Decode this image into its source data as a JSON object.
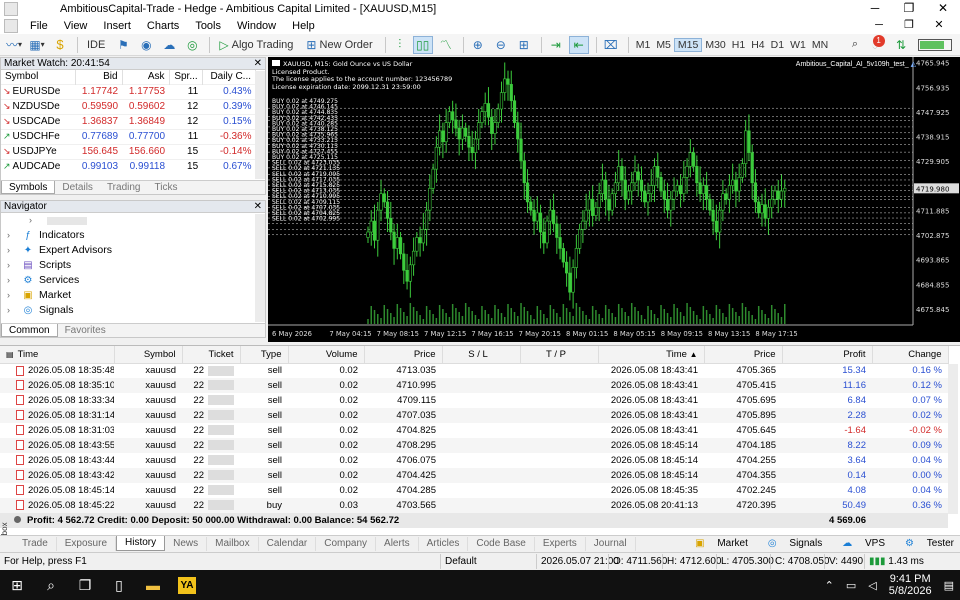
{
  "window": {
    "title": "AmbitiousCapital-Trade - Hedge - Ambitious Capital Limited - [XAUUSD,M15]"
  },
  "menu": [
    "File",
    "View",
    "Insert",
    "Charts",
    "Tools",
    "Window",
    "Help"
  ],
  "toolbar": {
    "ide": "IDE",
    "algo_trading": "Algo Trading",
    "new_order": "New Order",
    "timeframes": [
      "M1",
      "M5",
      "M15",
      "M30",
      "H1",
      "H4",
      "D1",
      "W1",
      "MN"
    ],
    "active_tf": "M15",
    "notifications": "1"
  },
  "market_watch": {
    "title": "Market Watch: 20:41:54",
    "columns": [
      "Symbol",
      "Bid",
      "Ask",
      "Spr...",
      "Daily C..."
    ],
    "rows": [
      {
        "symbol": "EURUSDe",
        "dir": "down",
        "bid": "1.17742",
        "ask": "1.17753",
        "spread": "11",
        "change": "0.43%"
      },
      {
        "symbol": "NZDUSDe",
        "dir": "down",
        "bid": "0.59590",
        "ask": "0.59602",
        "spread": "12",
        "change": "0.39%"
      },
      {
        "symbol": "USDCADe",
        "dir": "down",
        "bid": "1.36837",
        "ask": "1.36849",
        "spread": "12",
        "change": "0.15%"
      },
      {
        "symbol": "USDCHFe",
        "dir": "up",
        "bid": "0.77689",
        "ask": "0.77700",
        "spread": "11",
        "change": "-0.36%"
      },
      {
        "symbol": "USDJPYe",
        "dir": "down",
        "bid": "156.645",
        "ask": "156.660",
        "spread": "15",
        "change": "-0.14%"
      },
      {
        "symbol": "AUDCADe",
        "dir": "up",
        "bid": "0.99103",
        "ask": "0.99118",
        "spread": "15",
        "change": "0.67%"
      }
    ],
    "tabs": [
      "Symbols",
      "Details",
      "Trading",
      "Ticks"
    ]
  },
  "navigator": {
    "title": "Navigator",
    "items": [
      "Indicators",
      "Expert Advisors",
      "Scripts",
      "Services",
      "Market",
      "Signals"
    ],
    "tabs": [
      "Common",
      "Favorites"
    ]
  },
  "chart": {
    "header": "XAUUSD, M15:  Gold Ounce vs US Dollar",
    "info_lines": [
      "Licensed Product.",
      "The license applies to the account number: 123456789",
      "License expiration date: 2099.12.31 23:59:00"
    ],
    "ea_name": "Ambitious_Capital_AI_5v109h_test_",
    "current_price": "4719.980",
    "buy_labels": [
      "BUY 0.02 at 4749.275",
      "BUY 0.02 at 4746.145",
      "BUY 0.02 at 4744.835",
      "BUY 0.02 at 4742.435",
      "BUY 0.02 at 4740.285",
      "BUY 0.02 at 4738.125",
      "BUY 0.02 at 4735.965",
      "BUY 0.02 at 4733.215",
      "BUY 0.02 at 4730.115",
      "BUY 0.02 at 4727.455",
      "BUY 0.02 at 4725.115"
    ],
    "sell_labels": [
      "SELL 0.02 at 4723.035",
      "SELL 0.02 at 4721.135",
      "SELL 0.02 at 4719.095",
      "SELL 0.02 at 4717.035",
      "SELL 0.02 at 4715.825",
      "SELL 0.02 at 4713.035",
      "SELL 0.02 at 4710.995",
      "SELL 0.02 at 4709.115",
      "SELL 0.02 at 4707.035",
      "SELL 0.02 at 4704.825",
      "SELL 0.02 at 4702.995"
    ],
    "y_ticks": [
      "4765.945",
      "4756.935",
      "4747.925",
      "4738.915",
      "4729.905",
      "4719.980",
      "4711.885",
      "4702.875",
      "4693.865",
      "4684.855",
      "4675.845"
    ],
    "x_ticks": [
      "6 May 2026",
      "7 May 04:15",
      "7 May 08:15",
      "7 May 12:15",
      "7 May 16:15",
      "7 May 20:15",
      "8 May 01:15",
      "8 May 05:15",
      "8 May 09:15",
      "8 May 13:15",
      "8 May 17:15"
    ],
    "closes": [
      4704,
      4708,
      4701,
      4712,
      4718,
      4715,
      4709,
      4704,
      4698,
      4702,
      4696,
      4690,
      4686,
      4692,
      4697,
      4702,
      4700,
      4705,
      4712,
      4720,
      4727,
      4735,
      4741,
      4737,
      4744,
      4748,
      4745,
      4742,
      4738,
      4742,
      4739,
      4735,
      4733,
      4738,
      4744,
      4748,
      4751,
      4746,
      4740,
      4744,
      4749,
      4755,
      4760,
      4758,
      4752,
      4744,
      4738,
      4730,
      4722,
      4715,
      4712,
      4708,
      4711,
      4704,
      4700,
      4708,
      4712,
      4707,
      4702,
      4698,
      4693,
      4689,
      4682,
      4691,
      4698,
      4705,
      4708,
      4712,
      4716,
      4710,
      4713,
      4718,
      4723,
      4716,
      4712,
      4718,
      4722,
      4728,
      4723,
      4716,
      4719,
      4722,
      4726,
      4723,
      4719,
      4715,
      4718,
      4721,
      4728,
      4724,
      4719,
      4716,
      4712,
      4716,
      4719,
      4721,
      4718,
      4724,
      4728,
      4733,
      4728,
      4722,
      4718,
      4721,
      4716,
      4712,
      4708,
      4704,
      4712,
      4718,
      4716,
      4721,
      4723,
      4719,
      4724,
      4729,
      4741,
      4733,
      4722,
      4715,
      4711,
      4714,
      4709,
      4713,
      4716,
      4719,
      4716,
      4719,
      4720
    ]
  },
  "terminal": {
    "columns": [
      "Time",
      "Symbol",
      "Ticket",
      "Type",
      "Volume",
      "Price",
      "S / L",
      "T / P",
      "Time",
      "Price",
      "Profit",
      "Change"
    ],
    "rows": [
      {
        "open": "2026.05.08 18:35:48",
        "symbol": "xauusd",
        "ticket": "22",
        "type": "sell",
        "volume": "0.02",
        "price": "4713.035",
        "sl": "",
        "tp": "",
        "close": "2026.05.08 18:43:41",
        "cprice": "4705.365",
        "profit": "15.34",
        "change": "0.16 %"
      },
      {
        "open": "2026.05.08 18:35:10",
        "symbol": "xauusd",
        "ticket": "22",
        "type": "sell",
        "volume": "0.02",
        "price": "4710.995",
        "sl": "",
        "tp": "",
        "close": "2026.05.08 18:43:41",
        "cprice": "4705.415",
        "profit": "11.16",
        "change": "0.12 %"
      },
      {
        "open": "2026.05.08 18:33:34",
        "symbol": "xauusd",
        "ticket": "22",
        "type": "sell",
        "volume": "0.02",
        "price": "4709.115",
        "sl": "",
        "tp": "",
        "close": "2026.05.08 18:43:41",
        "cprice": "4705.695",
        "profit": "6.84",
        "change": "0.07 %"
      },
      {
        "open": "2026.05.08 18:31:14",
        "symbol": "xauusd",
        "ticket": "22",
        "type": "sell",
        "volume": "0.02",
        "price": "4707.035",
        "sl": "",
        "tp": "",
        "close": "2026.05.08 18:43:41",
        "cprice": "4705.895",
        "profit": "2.28",
        "change": "0.02 %"
      },
      {
        "open": "2026.05.08 18:31:03",
        "symbol": "xauusd",
        "ticket": "22",
        "type": "sell",
        "volume": "0.02",
        "price": "4704.825",
        "sl": "",
        "tp": "",
        "close": "2026.05.08 18:43:41",
        "cprice": "4705.645",
        "profit": "-1.64",
        "change": "-0.02 %"
      },
      {
        "open": "2026.05.08 18:43:55",
        "symbol": "xauusd",
        "ticket": "22",
        "type": "sell",
        "volume": "0.02",
        "price": "4708.295",
        "sl": "",
        "tp": "",
        "close": "2026.05.08 18:45:14",
        "cprice": "4704.185",
        "profit": "8.22",
        "change": "0.09 %"
      },
      {
        "open": "2026.05.08 18:43:44",
        "symbol": "xauusd",
        "ticket": "22",
        "type": "sell",
        "volume": "0.02",
        "price": "4706.075",
        "sl": "",
        "tp": "",
        "close": "2026.05.08 18:45:14",
        "cprice": "4704.255",
        "profit": "3.64",
        "change": "0.04 %"
      },
      {
        "open": "2026.05.08 18:43:42",
        "symbol": "xauusd",
        "ticket": "22",
        "type": "sell",
        "volume": "0.02",
        "price": "4704.425",
        "sl": "",
        "tp": "",
        "close": "2026.05.08 18:45:14",
        "cprice": "4704.355",
        "profit": "0.14",
        "change": "0.00 %"
      },
      {
        "open": "2026.05.08 18:45:14",
        "symbol": "xauusd",
        "ticket": "22",
        "type": "sell",
        "volume": "0.02",
        "price": "4704.285",
        "sl": "",
        "tp": "",
        "close": "2026.05.08 18:45:35",
        "cprice": "4702.245",
        "profit": "4.08",
        "change": "0.04 %"
      },
      {
        "open": "2026.05.08 18:45:22",
        "symbol": "xauusd",
        "ticket": "22",
        "type": "buy",
        "volume": "0.03",
        "price": "4703.565",
        "sl": "",
        "tp": "",
        "close": "2026.05.08 20:41:13",
        "cprice": "4720.395",
        "profit": "50.49",
        "change": "0.36 %"
      }
    ],
    "summary": {
      "text": "Profit: 4 562.72  Credit: 0.00  Deposit: 50 000.00  Withdrawal: 0.00  Balance: 54 562.72",
      "total": "4 569.06"
    },
    "tabs": [
      "Trade",
      "Exposure",
      "History",
      "News",
      "Mailbox",
      "Calendar",
      "Company",
      "Alerts",
      "Articles",
      "Code Base",
      "Experts",
      "Journal"
    ],
    "active_tab": "History",
    "right_tabs": [
      "Market",
      "Signals",
      "VPS",
      "Tester"
    ],
    "toolbox_label": "Toolbox"
  },
  "status": {
    "help": "For Help, press F1",
    "profile": "Default",
    "bar_time": "2026.05.07 21:00",
    "open": "O: 4711.560",
    "high": "H: 4712.600",
    "low": "L: 4705.300",
    "close": "C: 4708.050",
    "volume": "V: 4490",
    "ping": "1.43 ms"
  },
  "taskbar": {
    "time": "9:41 PM",
    "date": "5/8/2026",
    "app": "YA"
  }
}
